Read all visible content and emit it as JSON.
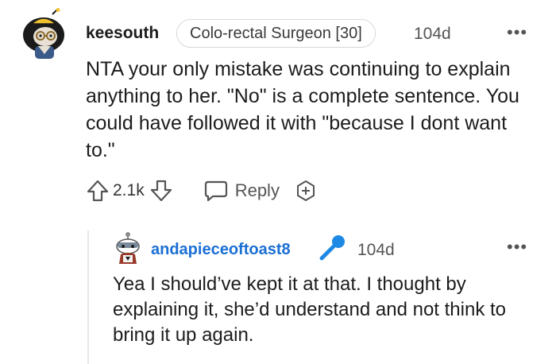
{
  "comment": {
    "username": "keesouth",
    "flair": "Colo-rectal Surgeon [30]",
    "age": "104d",
    "more": "•••",
    "body": "NTA your only mistake was continuing to explain anything to her. \"No\" is a complete sentence. You could have followed it with \"because I dont want to.\"",
    "score": "2.1k",
    "reply_label": "Reply"
  },
  "reply": {
    "username": "andapieceoftoast8",
    "age": "104d",
    "more": "•••",
    "body": "Yea I should’ve kept it at that. I thought by explaining it, she’d understand and not think to bring it up again."
  },
  "colors": {
    "username_link": "#1a6fd4",
    "mic_icon": "#1e88e5",
    "text": "#1c1c1c",
    "meta": "#555555"
  }
}
